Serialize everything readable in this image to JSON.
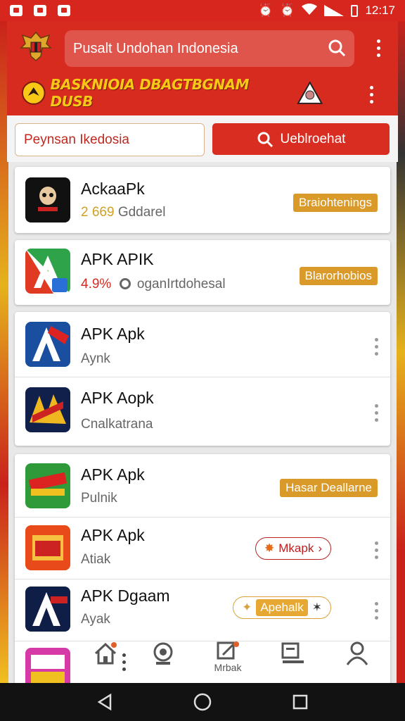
{
  "status_bar": {
    "time": "12:17"
  },
  "app_bar": {
    "search_placeholder": "Pusalt Undohan Indonesia"
  },
  "banner": {
    "title": "BASKNIOIA DBAGTBGNAM DUSB"
  },
  "search_row": {
    "field_value": "Peynsan Ikedosia",
    "button_label": "Ueblroehat"
  },
  "featured": [
    {
      "name": "AckaaPk",
      "rating": "2 669",
      "downloads": "Gddarel",
      "tag": "Braiohtenings",
      "icon": "skull-app-icon"
    },
    {
      "name": "APK APIK",
      "rating": "4.9%",
      "downloads": "oganIrtdohesal",
      "tag": "Blarorhobios",
      "icon": "a-letter-app-icon"
    }
  ],
  "list_a": [
    {
      "name": "APK Apk",
      "sub": "Aynk",
      "icon": "a-triangle-app-icon"
    },
    {
      "name": "APK Aopk",
      "sub": "Cnalkatrana",
      "icon": "hero-poster-app-icon"
    }
  ],
  "list_b": [
    {
      "name": "APK Apk",
      "sub": "Pulnik",
      "tag": "Hasar Deallarne",
      "icon": "green-game-app-icon"
    },
    {
      "name": "APK Apk",
      "sub": "Atiak",
      "pill": "Mkapk",
      "icon": "orange-app-icon"
    },
    {
      "name": "APK Dgaam",
      "sub": "Ayak",
      "pill": "Apehalk",
      "icon": "a-dark-app-icon"
    }
  ],
  "bottom_nav": {
    "label_3": "Mrbak"
  },
  "colors": {
    "primary": "#d72b20",
    "accent": "#f7c816",
    "tag": "#d99a2a"
  }
}
